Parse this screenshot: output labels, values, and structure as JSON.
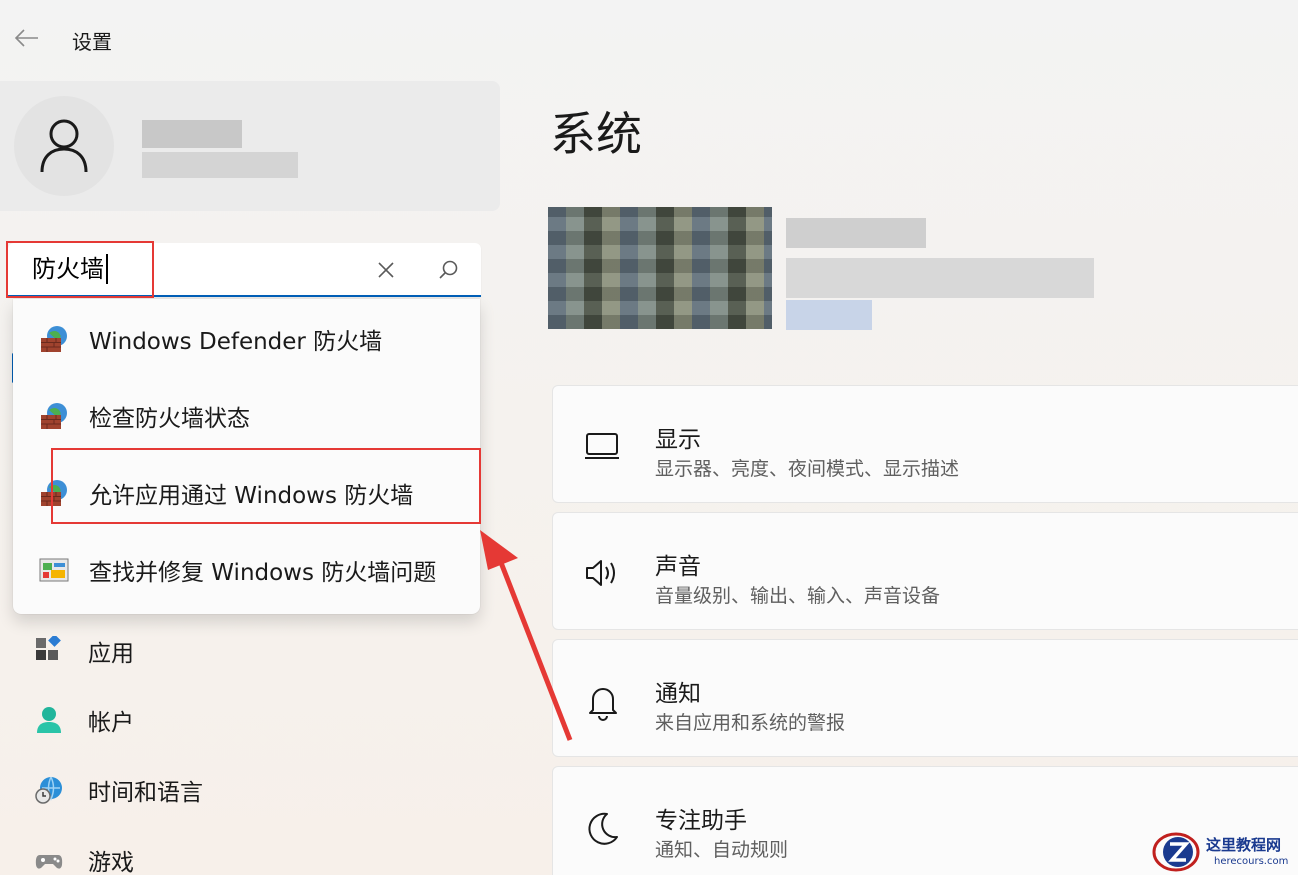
{
  "window": {
    "title": "设置"
  },
  "search": {
    "value": "防火墙",
    "results": [
      {
        "label": "Windows Defender 防火墙",
        "icon": "firewall-globe-icon"
      },
      {
        "label": "检查防火墙状态",
        "icon": "firewall-globe-icon"
      },
      {
        "label": "允许应用通过 Windows 防火墙",
        "icon": "firewall-globe-icon"
      },
      {
        "label": "查找并修复 Windows 防火墙问题",
        "icon": "troubleshoot-icon"
      }
    ]
  },
  "sidebar": {
    "items": [
      {
        "label": "应用",
        "icon": "apps-icon"
      },
      {
        "label": "帐户",
        "icon": "account-icon"
      },
      {
        "label": "时间和语言",
        "icon": "time-language-icon"
      },
      {
        "label": "游戏",
        "icon": "gaming-icon"
      }
    ]
  },
  "main": {
    "title": "系统",
    "cards": [
      {
        "title": "显示",
        "subtitle": "显示器、亮度、夜间模式、显示描述",
        "icon": "display-icon"
      },
      {
        "title": "声音",
        "subtitle": "音量级别、输出、输入、声音设备",
        "icon": "speaker-icon"
      },
      {
        "title": "通知",
        "subtitle": "来自应用和系统的警报",
        "icon": "bell-icon"
      },
      {
        "title": "专注助手",
        "subtitle": "通知、自动规则",
        "icon": "moon-icon"
      }
    ]
  },
  "watermark": {
    "name": "这里教程网",
    "url": "herecours.com"
  },
  "colors": {
    "accent": "#005fb8",
    "annotation": "#e53935"
  }
}
